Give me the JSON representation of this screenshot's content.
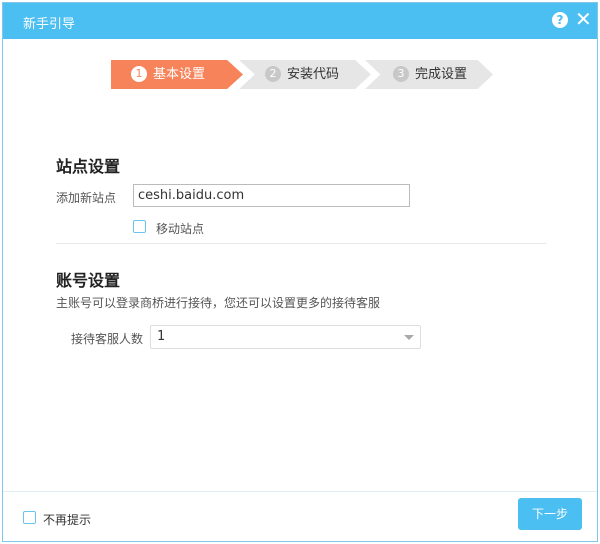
{
  "dialog": {
    "title": "新手引导",
    "help_icon": "?",
    "close_icon": "✕"
  },
  "steps": [
    {
      "num": "1",
      "label": "基本设置"
    },
    {
      "num": "2",
      "label": "安装代码"
    },
    {
      "num": "3",
      "label": "完成设置"
    }
  ],
  "site": {
    "heading": "站点设置",
    "add_label": "添加新站点",
    "add_value": "ceshi.baidu.com",
    "mobile_label": "移动站点"
  },
  "account": {
    "heading": "账号设置",
    "desc": "主账号可以登录商桥进行接待，您还可以设置更多的接待客服",
    "count_label": "接待客服人数",
    "count_value": "1"
  },
  "footer": {
    "no_remind": "不再提示",
    "next": "下一步"
  }
}
